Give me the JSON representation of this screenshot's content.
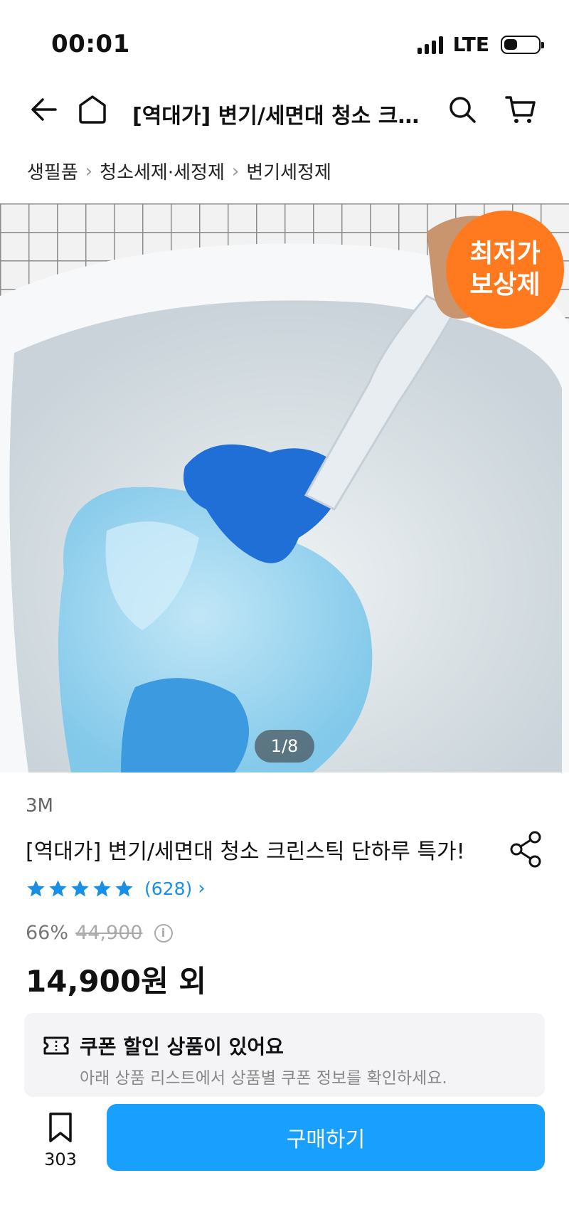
{
  "status_bar": {
    "time": "00:01",
    "network": "LTE"
  },
  "nav": {
    "title": "[역대가] 변기/세면대 청소 크린…",
    "icons": [
      "back-arrow-icon",
      "home-icon",
      "search-icon",
      "cart-icon"
    ]
  },
  "breadcrumb": {
    "items": [
      "생필품",
      "청소세제·세정제",
      "변기세정제"
    ]
  },
  "hero": {
    "badge_line1": "최저가",
    "badge_line2": "보상제",
    "pager": "1/8",
    "badge_color": "#ff7a1f"
  },
  "product": {
    "brand": "3M",
    "title": "[역대가] 변기/세면대 청소 크린스틱 단하루 특가!",
    "rating_stars": 5,
    "review_count": "(628)",
    "discount": "66%",
    "original_price": "44,900",
    "sale_price": "14,900원 외"
  },
  "coupon": {
    "title": "쿠폰 할인 상품이 있어요",
    "subtitle": "아래 상품 리스트에서 상품별 쿠폰 정보를 확인하세요."
  },
  "bottom_bar": {
    "bookmark_count": "303",
    "buy_label": "구매하기",
    "accent_color": "#19a0ff"
  }
}
